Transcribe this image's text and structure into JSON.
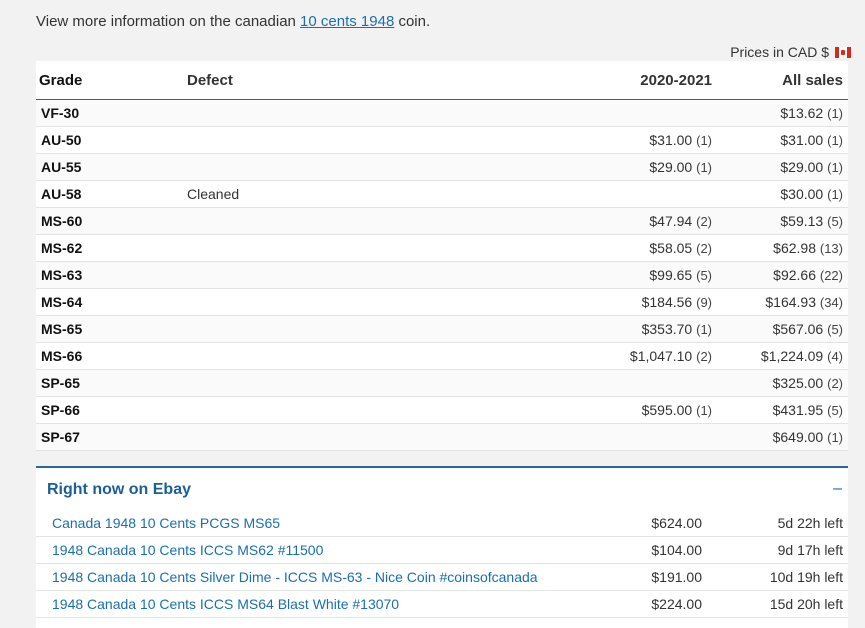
{
  "intro": {
    "prefix": "View more information on the canadian ",
    "link": "10 cents 1948",
    "suffix": " coin."
  },
  "prices_note": "Prices in CAD $",
  "table": {
    "headers": {
      "grade": "Grade",
      "defect": "Defect",
      "period": "2020-2021",
      "all": "All sales"
    },
    "rows": [
      {
        "grade": "VF-30",
        "defect": "",
        "period": "",
        "period_count": "",
        "all": "$13.62",
        "all_count": "(1)"
      },
      {
        "grade": "AU-50",
        "defect": "",
        "period": "$31.00",
        "period_count": "(1)",
        "all": "$31.00",
        "all_count": "(1)"
      },
      {
        "grade": "AU-55",
        "defect": "",
        "period": "$29.00",
        "period_count": "(1)",
        "all": "$29.00",
        "all_count": "(1)"
      },
      {
        "grade": "AU-58",
        "defect": "Cleaned",
        "period": "",
        "period_count": "",
        "all": "$30.00",
        "all_count": "(1)"
      },
      {
        "grade": "MS-60",
        "defect": "",
        "period": "$47.94",
        "period_count": "(2)",
        "all": "$59.13",
        "all_count": "(5)"
      },
      {
        "grade": "MS-62",
        "defect": "",
        "period": "$58.05",
        "period_count": "(2)",
        "all": "$62.98",
        "all_count": "(13)"
      },
      {
        "grade": "MS-63",
        "defect": "",
        "period": "$99.65",
        "period_count": "(5)",
        "all": "$92.66",
        "all_count": "(22)"
      },
      {
        "grade": "MS-64",
        "defect": "",
        "period": "$184.56",
        "period_count": "(9)",
        "all": "$164.93",
        "all_count": "(34)"
      },
      {
        "grade": "MS-65",
        "defect": "",
        "period": "$353.70",
        "period_count": "(1)",
        "all": "$567.06",
        "all_count": "(5)"
      },
      {
        "grade": "MS-66",
        "defect": "",
        "period": "$1,047.10",
        "period_count": "(2)",
        "all": "$1,224.09",
        "all_count": "(4)"
      },
      {
        "grade": "SP-65",
        "defect": "",
        "period": "",
        "period_count": "",
        "all": "$325.00",
        "all_count": "(2)"
      },
      {
        "grade": "SP-66",
        "defect": "",
        "period": "$595.00",
        "period_count": "(1)",
        "all": "$431.95",
        "all_count": "(5)"
      },
      {
        "grade": "SP-67",
        "defect": "",
        "period": "",
        "period_count": "",
        "all": "$649.00",
        "all_count": "(1)"
      }
    ]
  },
  "ebay": {
    "title": "Right now on Ebay",
    "toggle": "–",
    "listings": [
      {
        "title": "Canada 1948 10 Cents PCGS MS65",
        "price": "$624.00",
        "time_left": "5d 22h left"
      },
      {
        "title": "1948 Canada 10 Cents ICCS MS62 #11500",
        "price": "$104.00",
        "time_left": "9d 17h left"
      },
      {
        "title": "1948 Canada 10 Cents Silver Dime - ICCS MS-63 - Nice Coin #coinsofcanada",
        "price": "$191.00",
        "time_left": "10d 19h left"
      },
      {
        "title": "1948 Canada 10 Cents ICCS MS64 Blast White #13070",
        "price": "$224.00",
        "time_left": "15d 20h left"
      }
    ]
  },
  "icons": {
    "flag": "canada-flag-icon"
  },
  "colors": {
    "link": "#1a6fb0",
    "accent": "#2a6899",
    "ebay_title": "#1a5f95"
  }
}
